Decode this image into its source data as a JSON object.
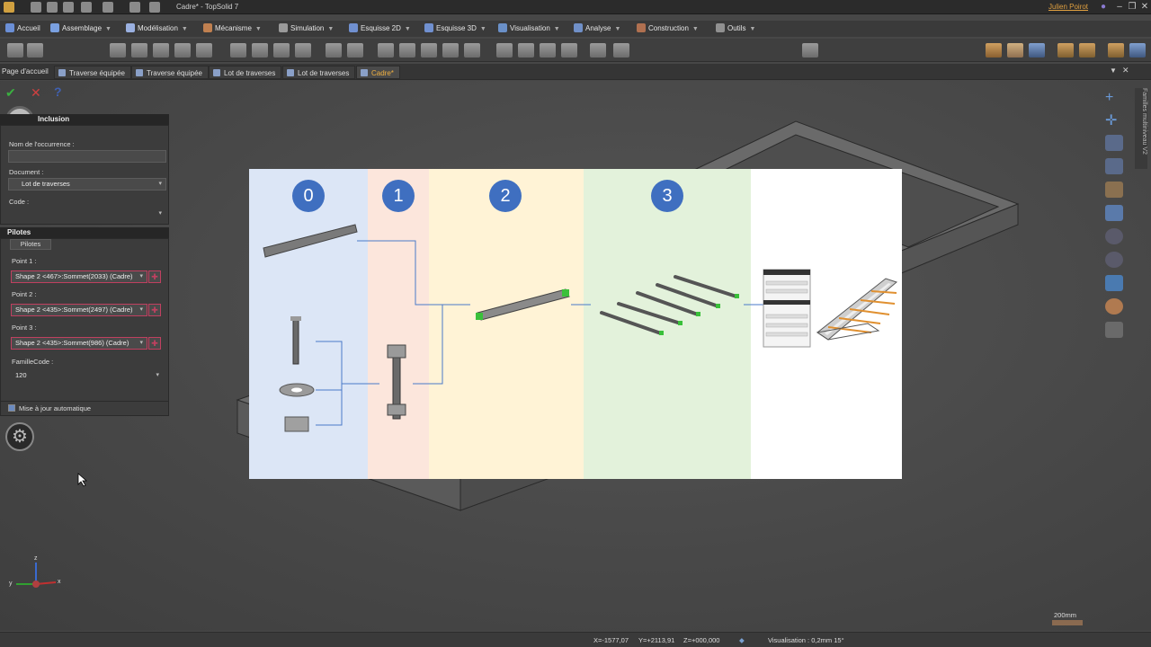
{
  "window": {
    "title": "Cadre* - TopSolid 7",
    "user": "Julien Poirot"
  },
  "menus": [
    {
      "label": "Accueil",
      "color": "#6b8fd6"
    },
    {
      "label": "Assemblage",
      "color": "#7aa0e0"
    },
    {
      "label": "Modélisation",
      "color": "#9ab0e0"
    },
    {
      "label": "Mécanisme",
      "color": "#c08050"
    },
    {
      "label": "Simulation",
      "color": "#9a9a9a"
    },
    {
      "label": "Esquisse 2D",
      "color": "#7090d0"
    },
    {
      "label": "Esquisse 3D",
      "color": "#7090d0"
    },
    {
      "label": "Visualisation",
      "color": "#6a90c8"
    },
    {
      "label": "Analyse",
      "color": "#7090c8"
    },
    {
      "label": "Construction",
      "color": "#b07050"
    },
    {
      "label": "Outils",
      "color": "#909090"
    }
  ],
  "tabs": [
    {
      "label": "Page d'accueil",
      "active": false
    },
    {
      "label": "Traverse équipée",
      "active": false
    },
    {
      "label": "Traverse équipée",
      "active": false
    },
    {
      "label": "Lot de traverses",
      "active": false
    },
    {
      "label": "Lot de traverses",
      "active": false
    },
    {
      "label": "Cadre*",
      "active": true
    }
  ],
  "panel": {
    "header": "Inclusion",
    "occurrence_label": "Nom de l'occurrence :",
    "occurrence_value": "",
    "document_label": "Document :",
    "document_value": "Lot de traverses",
    "code_label": "Code :",
    "code_value": "",
    "pilotes_header": "Pilotes",
    "pilotes_tab": "Pilotes",
    "points": [
      {
        "label": "Point 1 :",
        "value": "Shape 2 <467>:Sommet(2033) (Cadre)"
      },
      {
        "label": "Point 2 :",
        "value": "Shape 2 <435>:Sommet(2497) (Cadre)"
      },
      {
        "label": "Point 3 :",
        "value": "Shape 2 <435>:Sommet(986) (Cadre)"
      }
    ],
    "famille_label": "FamilleCode :",
    "famille_value": "120",
    "auto_update_label": "Mise à jour automatique",
    "auto_update_checked": true
  },
  "overlay": {
    "steps": [
      "0",
      "1",
      "2",
      "3"
    ],
    "colors": {
      "step0": "#dce6f6",
      "step1": "#fce6dc",
      "step2": "#fff3d6",
      "step3": "#e3f2db",
      "circle": "#3f6fc0"
    }
  },
  "status": {
    "x": "X=-1577,07",
    "y": "Y=+2113,91",
    "z": "Z=+000,000",
    "visualisation": "Visualisation : 0,2mm 15°",
    "scale": "200mm"
  },
  "right_panel_label": "Familles multiniveau V2",
  "axes": {
    "x": "x",
    "y": "y",
    "z": "z"
  }
}
